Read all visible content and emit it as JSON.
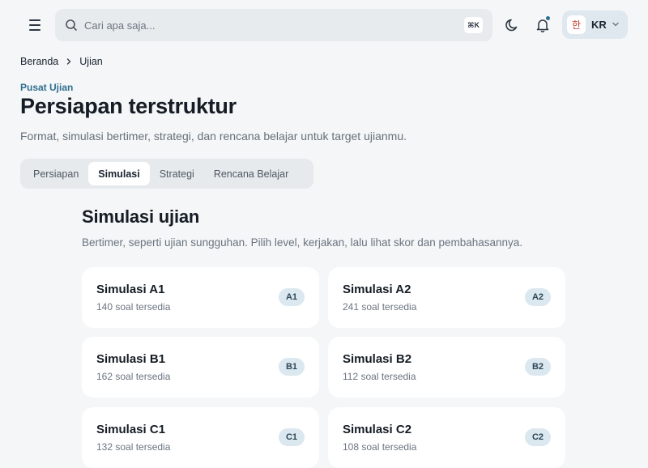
{
  "search": {
    "placeholder": "Cari apa saja...",
    "shortcut": "⌘K"
  },
  "language": {
    "flag": "한",
    "code": "KR"
  },
  "breadcrumb": {
    "home": "Beranda",
    "current": "Ujian"
  },
  "header": {
    "eyebrow": "Pusat Ujian",
    "title": "Persiapan terstruktur",
    "subtitle": "Format, simulasi bertimer, strategi, dan rencana belajar untuk target ujianmu."
  },
  "tabs": [
    {
      "label": "Persiapan"
    },
    {
      "label": "Simulasi"
    },
    {
      "label": "Strategi"
    },
    {
      "label": "Rencana Belajar"
    }
  ],
  "active_tab": "Simulasi",
  "section": {
    "title": "Simulasi ujian",
    "subtitle": "Bertimer, seperti ujian sungguhan. Pilih level, kerjakan, lalu lihat skor dan pembahasannya."
  },
  "cards": [
    {
      "title": "Simulasi A1",
      "count": "140 soal tersedia",
      "badge": "A1"
    },
    {
      "title": "Simulasi A2",
      "count": "241 soal tersedia",
      "badge": "A2"
    },
    {
      "title": "Simulasi B1",
      "count": "162 soal tersedia",
      "badge": "B1"
    },
    {
      "title": "Simulasi B2",
      "count": "112 soal tersedia",
      "badge": "B2"
    },
    {
      "title": "Simulasi C1",
      "count": "132 soal tersedia",
      "badge": "C1"
    },
    {
      "title": "Simulasi C2",
      "count": "108 soal tersedia",
      "badge": "C2"
    }
  ],
  "colors": {
    "accent": "#2f6f8f",
    "background": "#f4f6f7",
    "badge_bg": "#dbe8f0"
  }
}
